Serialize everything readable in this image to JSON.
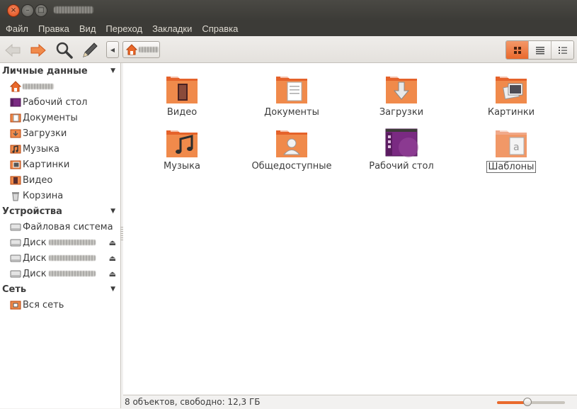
{
  "window": {
    "close_label": "×",
    "minimize_label": "–",
    "maximize_label": "□"
  },
  "menu": [
    "Файл",
    "Правка",
    "Вид",
    "Переход",
    "Закладки",
    "Справка"
  ],
  "sidebar": {
    "personal": {
      "title": "Личные данные",
      "items": [
        {
          "label": "",
          "icon": "home-folder-icon"
        },
        {
          "label": "Рабочий стол",
          "icon": "desktop-folder-icon"
        },
        {
          "label": "Документы",
          "icon": "documents-folder-icon"
        },
        {
          "label": "Загрузки",
          "icon": "downloads-folder-icon"
        },
        {
          "label": "Музыка",
          "icon": "music-folder-icon"
        },
        {
          "label": "Картинки",
          "icon": "pictures-folder-icon"
        },
        {
          "label": "Видео",
          "icon": "video-folder-icon"
        },
        {
          "label": "Корзина",
          "icon": "trash-icon"
        }
      ]
    },
    "devices": {
      "title": "Устройства",
      "items": [
        {
          "label": "Файловая система",
          "icon": "harddisk-icon"
        },
        {
          "label": "Диск",
          "icon": "harddisk-icon"
        },
        {
          "label": "Диск",
          "icon": "harddisk-icon"
        },
        {
          "label": "Диск",
          "icon": "harddisk-icon"
        }
      ]
    },
    "network": {
      "title": "Сеть",
      "items": [
        {
          "label": "Вся сеть",
          "icon": "network-folder-icon"
        }
      ]
    }
  },
  "folders": [
    {
      "label": "Видео",
      "icon": "video-folder-icon"
    },
    {
      "label": "Документы",
      "icon": "documents-folder-icon"
    },
    {
      "label": "Загрузки",
      "icon": "downloads-folder-icon"
    },
    {
      "label": "Картинки",
      "icon": "pictures-folder-icon"
    },
    {
      "label": "Музыка",
      "icon": "music-folder-icon"
    },
    {
      "label": "Общедоступные",
      "icon": "public-folder-icon"
    },
    {
      "label": "Рабочий стол",
      "icon": "desktop-folder-icon"
    },
    {
      "label": "Шаблоны",
      "icon": "templates-folder-icon"
    }
  ],
  "status": {
    "text": "8 объектов, свободно: 12,3 ГБ",
    "zoom_fraction": 0.45
  },
  "colors": {
    "accent": "#e9692c",
    "titlebar": "#3c3b37",
    "menu_text": "#dfdbd2"
  }
}
